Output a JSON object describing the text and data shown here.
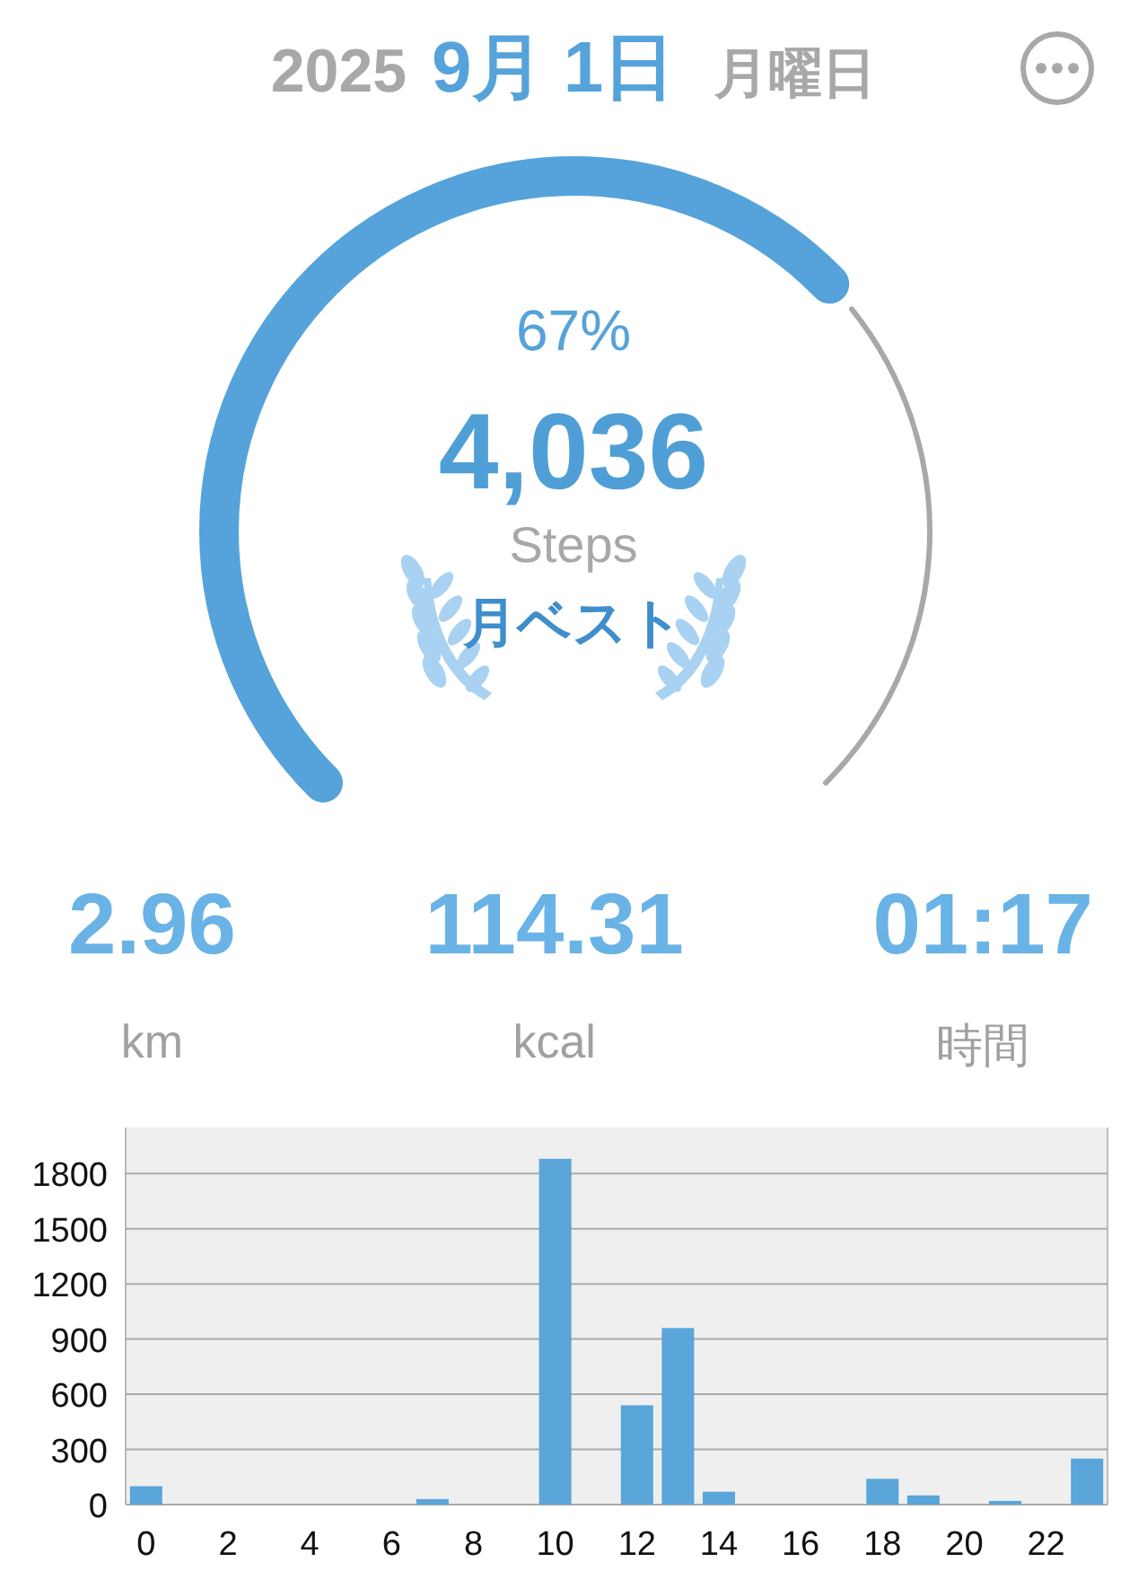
{
  "header": {
    "year": "2025",
    "date": "9月 1日",
    "weekday": "月曜日"
  },
  "ring": {
    "percent": "67%",
    "steps": "4,036",
    "unit": "Steps",
    "badge": "月ベスト"
  },
  "stats": [
    {
      "value": "2.96",
      "label": "km"
    },
    {
      "value": "114.31",
      "label": "kcal"
    },
    {
      "value": "01:17",
      "label": "時間"
    }
  ],
  "chart": {
    "chart_data": {
      "type": "bar",
      "x": [
        0,
        1,
        2,
        3,
        4,
        5,
        6,
        7,
        8,
        9,
        10,
        11,
        12,
        13,
        14,
        15,
        16,
        17,
        18,
        19,
        20,
        21,
        22,
        23
      ],
      "series": [
        {
          "color": "#5aa5da",
          "values": [
            100,
            0,
            0,
            0,
            0,
            0,
            0,
            30,
            0,
            0,
            1880,
            0,
            540,
            960,
            70,
            0,
            0,
            0,
            140,
            50,
            0,
            20,
            0,
            250
          ]
        }
      ],
      "ylim": [
        0,
        2050
      ],
      "yticks": [
        0,
        300,
        600,
        900,
        1200,
        1500,
        1800
      ],
      "grid": true,
      "xlim": [
        -0.5,
        23.5
      ],
      "xticks": [
        0,
        2,
        4,
        6,
        8,
        10,
        12,
        14,
        16,
        18,
        20,
        22
      ]
    }
  }
}
